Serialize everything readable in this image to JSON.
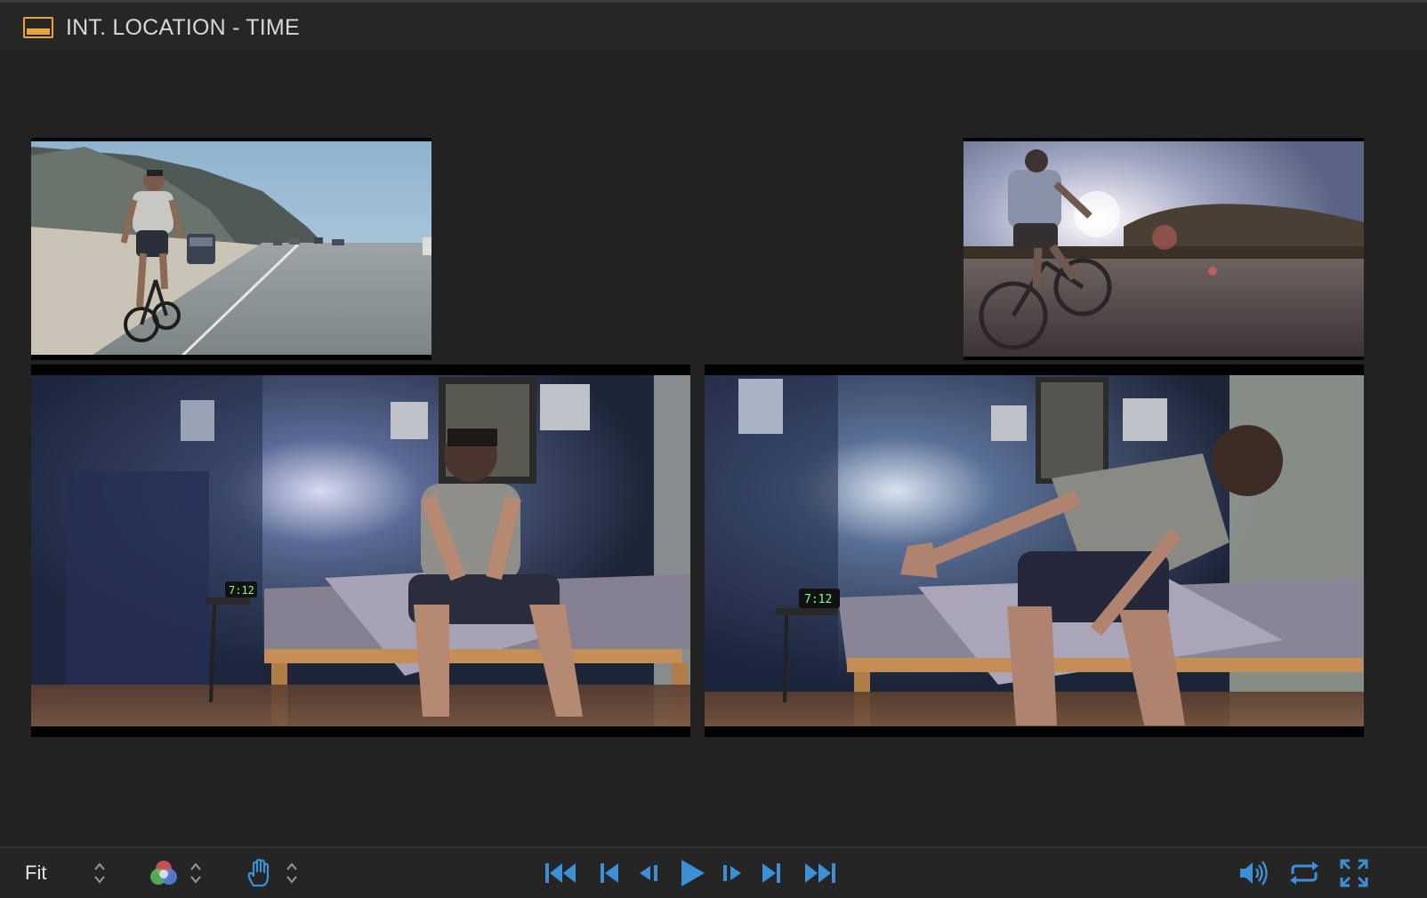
{
  "window": {
    "title": "INT. LOCATION - TIME",
    "title_icon": "scene-icon"
  },
  "viewer": {
    "clips": [
      {
        "name": "clip-top-left",
        "subject": "cyclist-on-highway"
      },
      {
        "name": "clip-top-right",
        "subject": "cyclist-sunset"
      },
      {
        "name": "clip-bottom-left",
        "subject": "man-sitting-on-bed",
        "clock_text": "7:12"
      },
      {
        "name": "clip-bottom-right",
        "subject": "man-reaching-clock",
        "clock_text": "7:12"
      }
    ]
  },
  "toolbar": {
    "zoom_label": "Fit",
    "color_channels_icon": "rgb-channels-icon",
    "hand_tool_icon": "hand-icon",
    "transport": [
      "go-to-start-icon",
      "previous-edit-icon",
      "step-back-icon",
      "play-icon",
      "step-forward-icon",
      "next-edit-icon",
      "go-to-end-icon"
    ],
    "right_controls": [
      "volume-icon",
      "loop-icon",
      "fullscreen-icon"
    ],
    "accent_color": "#3d8fd6"
  }
}
